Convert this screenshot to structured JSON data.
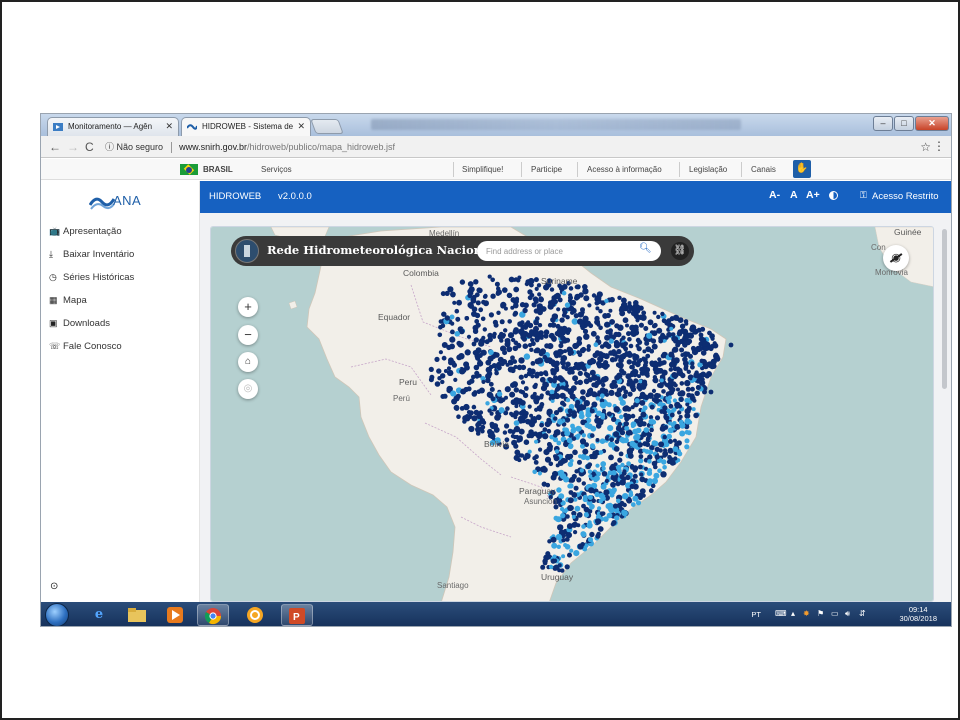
{
  "browser": {
    "tabs": [
      {
        "title": "Monitoramento — Agên",
        "active": false
      },
      {
        "title": "HIDROWEB - Sistema de",
        "active": true
      }
    ],
    "url": {
      "security_label": "Não seguro",
      "host": "www.snirh.gov.br",
      "path": "/hidroweb/publico/mapa_hidroweb.jsf"
    },
    "window_buttons": [
      "minimize",
      "maximize",
      "close"
    ]
  },
  "gov_bar": {
    "brand": "BRASIL",
    "services": "Serviços",
    "links": [
      "Simplifique!",
      "Participe",
      "Acesso à informação",
      "Legislação",
      "Canais"
    ]
  },
  "sidebar": {
    "logo_text": "ANA",
    "items": [
      {
        "label": "Apresentação",
        "icon": "tv-icon"
      },
      {
        "label": "Baixar Inventário",
        "icon": "download-icon"
      },
      {
        "label": "Séries Históricas",
        "icon": "clock-icon"
      },
      {
        "label": "Mapa",
        "icon": "map-icon"
      },
      {
        "label": "Downloads",
        "icon": "folder-download-icon"
      },
      {
        "label": "Fale Conosco",
        "icon": "contact-icon"
      }
    ]
  },
  "app_header": {
    "name": "HIDROWEB",
    "version": "v2.0.0.0",
    "font_decrease": "A-",
    "font_normal": "A",
    "font_increase": "A+",
    "restricted_access": "Acesso Restrito"
  },
  "map": {
    "title": "Rede Hidrometeorológica Nacional",
    "search": {
      "placeholder": "Find address or place",
      "value": ""
    },
    "controls": [
      "zoom-in",
      "zoom-out",
      "home",
      "locate"
    ],
    "labels": {
      "colombia": "Colombia",
      "ecuador": "Equador",
      "peru": "Peru",
      "peru2": "Perú",
      "bolivia": "Bolivia",
      "paraguay": "Paraguay",
      "asuncion": "Asunción",
      "uruguay": "Uruguay",
      "suriname": "Suriname",
      "guinee": "Guinée",
      "monrovia": "Monrovia",
      "santiago": "Santiago",
      "medellin": "Medellín",
      "con": "Con"
    },
    "colors": {
      "ocean": "#b5d0d0",
      "land": "#f2efe9",
      "station_dark": "#0d2d72",
      "station_light": "#3aa6e0"
    }
  },
  "taskbar": {
    "apps": [
      "ie",
      "explorer",
      "media-player",
      "chrome",
      "app-orange",
      "powerpoint"
    ],
    "tray_lang": "PT",
    "time": "09:14",
    "date": "30/08/2018"
  }
}
